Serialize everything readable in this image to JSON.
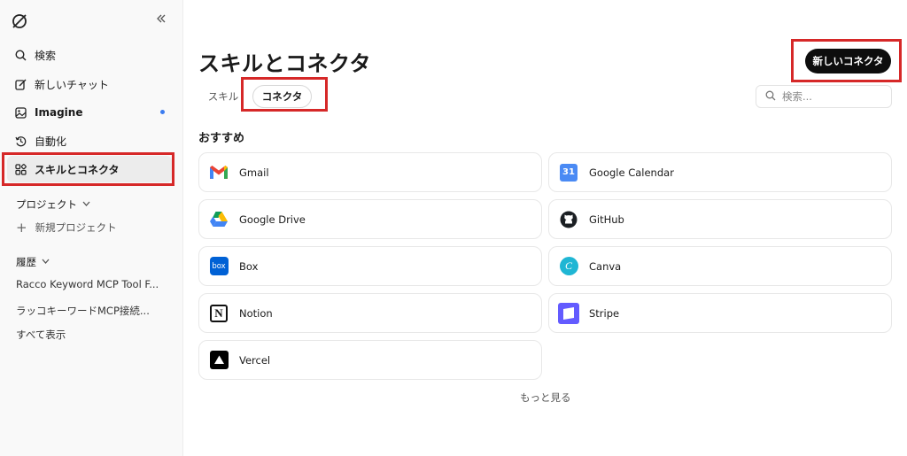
{
  "sidebar": {
    "collapse_icon": "double-chevron-left-icon",
    "nav": [
      {
        "label": "検索",
        "icon": "search-icon"
      },
      {
        "label": "新しいチャット",
        "icon": "edit-icon"
      },
      {
        "label": "Imagine",
        "icon": "image-icon",
        "dot_color": "#3b7cf0"
      },
      {
        "label": "自動化",
        "icon": "history-icon"
      },
      {
        "label": "スキルとコネクタ",
        "icon": "apps-icon",
        "active": true
      }
    ],
    "projects": {
      "label": "プロジェクト",
      "new_label": "新規プロジェクト"
    },
    "history": {
      "label": "履歴",
      "items": [
        "Racco Keyword MCP Tool F...",
        "ラッコキーワードMCP接続..."
      ],
      "show_all": "すべて表示"
    }
  },
  "main": {
    "title": "スキルとコネクタ",
    "new_button": "新しいコネクタ",
    "tabs": [
      {
        "label": "スキル",
        "selected": false
      },
      {
        "label": "コネクタ",
        "selected": true
      }
    ],
    "search_placeholder": "検索...",
    "section_title": "おすすめ",
    "connectors": [
      {
        "name": "Gmail",
        "icon": "gmail-icon"
      },
      {
        "name": "Google Calendar",
        "icon": "google-calendar-icon",
        "icon_text": "31"
      },
      {
        "name": "Google Drive",
        "icon": "google-drive-icon"
      },
      {
        "name": "GitHub",
        "icon": "github-icon"
      },
      {
        "name": "Box",
        "icon": "box-icon",
        "icon_text": "box"
      },
      {
        "name": "Canva",
        "icon": "canva-icon",
        "icon_text": "C"
      },
      {
        "name": "Notion",
        "icon": "notion-icon",
        "icon_text": "N"
      },
      {
        "name": "Stripe",
        "icon": "stripe-icon"
      },
      {
        "name": "Vercel",
        "icon": "vercel-icon"
      }
    ],
    "more_label": "もっと見る"
  },
  "colors": {
    "highlight": "#d62828",
    "accent_dot": "#3b7cf0",
    "button_bg": "#0d0d0d"
  }
}
